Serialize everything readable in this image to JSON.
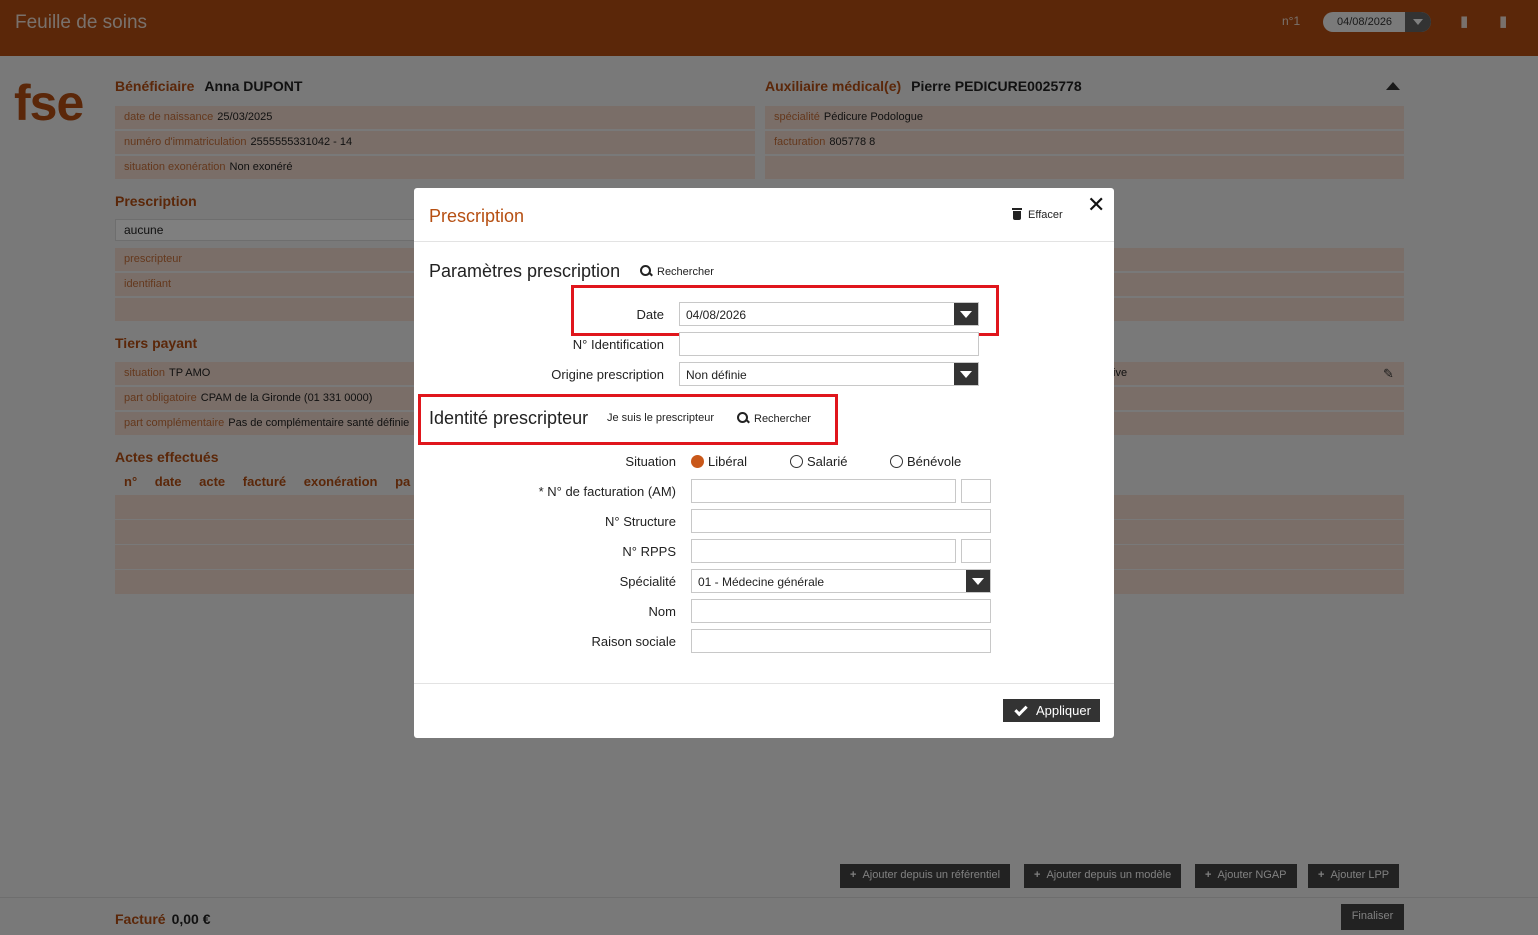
{
  "app": {
    "title": "Feuille de soins",
    "number": "n°1",
    "date": "04/08/2026",
    "logo": "fse"
  },
  "beneficiaire": {
    "label": "Bénéficiaire",
    "name": "Anna DUPONT",
    "rows": [
      {
        "label": "date de naissance",
        "value": "25/03/2025"
      },
      {
        "label": "numéro d'immatriculation",
        "value": "2555555331042 - 14"
      },
      {
        "label": "situation exonération",
        "value": "Non exonéré"
      }
    ]
  },
  "auxiliaire": {
    "label": "Auxiliaire médical(e)",
    "name": "Pierre PEDICURE0025778",
    "rows": [
      {
        "label": "spécialité",
        "value": "Pédicure Podologue"
      },
      {
        "label": "facturation",
        "value": "805778 8"
      }
    ]
  },
  "prescription_bg": {
    "label": "Prescription",
    "value": "aucune",
    "rows": [
      {
        "label": "prescripteur",
        "value": ""
      },
      {
        "label": "identifiant",
        "value": ""
      }
    ]
  },
  "tiers_payant": {
    "label": "Tiers payant",
    "rows": [
      {
        "label": "situation",
        "value": "TP AMO"
      },
      {
        "label": "part obligatoire",
        "value": "CPAM de la Gironde  (01 331 0000)"
      },
      {
        "label": "part complémentaire",
        "value": "Pas de complémentaire santé définie"
      }
    ],
    "right_fragment": "ive"
  },
  "actes": {
    "label": "Actes effectués",
    "columns": [
      "n°",
      "date",
      "acte",
      "facturé",
      "exonération",
      "pa"
    ]
  },
  "bottom_buttons": [
    "Ajouter depuis un référentiel",
    "Ajouter depuis un modèle",
    "Ajouter NGAP",
    "Ajouter LPP"
  ],
  "footer": {
    "label": "Facturé",
    "value": "0,00 €",
    "finaliser": "Finaliser"
  },
  "modal": {
    "title": "Prescription",
    "effacer": "Effacer",
    "params_title": "Paramètres prescription",
    "rechercher": "Rechercher",
    "date_label": "Date",
    "date_value": "04/08/2026",
    "identification_label": "N° Identification",
    "identification_value": "",
    "origine_label": "Origine prescription",
    "origine_value": "Non définie",
    "identity_title": "Identité prescripteur",
    "je_suis": "Je suis le prescripteur",
    "situation_label": "Situation",
    "situation_options": [
      "Libéral",
      "Salarié",
      "Bénévole"
    ],
    "situation_selected": "Libéral",
    "facturation_label": "*  N° de facturation (AM)",
    "facturation_value": "",
    "facturation_key": "",
    "structure_label": "N° Structure",
    "structure_value": "",
    "rpps_label": "N° RPPS",
    "rpps_value": "",
    "rpps_key": "",
    "specialite_label": "Spécialité",
    "specialite_value": "01 - Médecine générale",
    "nom_label": "Nom",
    "nom_value": "",
    "raison_label": "Raison sociale",
    "raison_value": "",
    "appliquer": "Appliquer"
  },
  "colors": {
    "brand": "#b64f12",
    "row_bg": "#f5ddd0",
    "highlight": "#e0161c",
    "radio_on": "#c9581a"
  }
}
